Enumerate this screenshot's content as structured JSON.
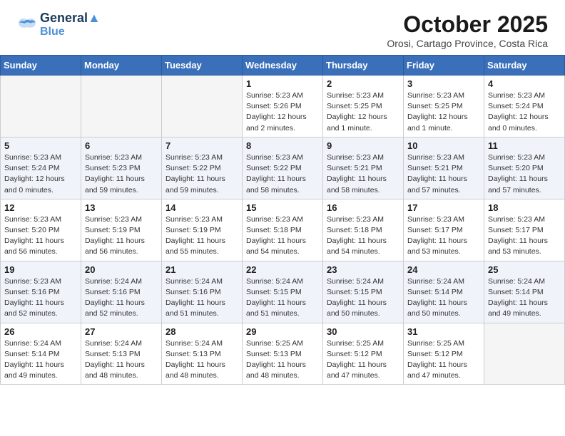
{
  "header": {
    "logo_line1": "General",
    "logo_line2": "Blue",
    "month_title": "October 2025",
    "subtitle": "Orosi, Cartago Province, Costa Rica"
  },
  "days_of_week": [
    "Sunday",
    "Monday",
    "Tuesday",
    "Wednesday",
    "Thursday",
    "Friday",
    "Saturday"
  ],
  "weeks": [
    [
      {
        "day": "",
        "info": ""
      },
      {
        "day": "",
        "info": ""
      },
      {
        "day": "",
        "info": ""
      },
      {
        "day": "1",
        "info": "Sunrise: 5:23 AM\nSunset: 5:26 PM\nDaylight: 12 hours\nand 2 minutes."
      },
      {
        "day": "2",
        "info": "Sunrise: 5:23 AM\nSunset: 5:25 PM\nDaylight: 12 hours\nand 1 minute."
      },
      {
        "day": "3",
        "info": "Sunrise: 5:23 AM\nSunset: 5:25 PM\nDaylight: 12 hours\nand 1 minute."
      },
      {
        "day": "4",
        "info": "Sunrise: 5:23 AM\nSunset: 5:24 PM\nDaylight: 12 hours\nand 0 minutes."
      }
    ],
    [
      {
        "day": "5",
        "info": "Sunrise: 5:23 AM\nSunset: 5:24 PM\nDaylight: 12 hours\nand 0 minutes."
      },
      {
        "day": "6",
        "info": "Sunrise: 5:23 AM\nSunset: 5:23 PM\nDaylight: 11 hours\nand 59 minutes."
      },
      {
        "day": "7",
        "info": "Sunrise: 5:23 AM\nSunset: 5:22 PM\nDaylight: 11 hours\nand 59 minutes."
      },
      {
        "day": "8",
        "info": "Sunrise: 5:23 AM\nSunset: 5:22 PM\nDaylight: 11 hours\nand 58 minutes."
      },
      {
        "day": "9",
        "info": "Sunrise: 5:23 AM\nSunset: 5:21 PM\nDaylight: 11 hours\nand 58 minutes."
      },
      {
        "day": "10",
        "info": "Sunrise: 5:23 AM\nSunset: 5:21 PM\nDaylight: 11 hours\nand 57 minutes."
      },
      {
        "day": "11",
        "info": "Sunrise: 5:23 AM\nSunset: 5:20 PM\nDaylight: 11 hours\nand 57 minutes."
      }
    ],
    [
      {
        "day": "12",
        "info": "Sunrise: 5:23 AM\nSunset: 5:20 PM\nDaylight: 11 hours\nand 56 minutes."
      },
      {
        "day": "13",
        "info": "Sunrise: 5:23 AM\nSunset: 5:19 PM\nDaylight: 11 hours\nand 56 minutes."
      },
      {
        "day": "14",
        "info": "Sunrise: 5:23 AM\nSunset: 5:19 PM\nDaylight: 11 hours\nand 55 minutes."
      },
      {
        "day": "15",
        "info": "Sunrise: 5:23 AM\nSunset: 5:18 PM\nDaylight: 11 hours\nand 54 minutes."
      },
      {
        "day": "16",
        "info": "Sunrise: 5:23 AM\nSunset: 5:18 PM\nDaylight: 11 hours\nand 54 minutes."
      },
      {
        "day": "17",
        "info": "Sunrise: 5:23 AM\nSunset: 5:17 PM\nDaylight: 11 hours\nand 53 minutes."
      },
      {
        "day": "18",
        "info": "Sunrise: 5:23 AM\nSunset: 5:17 PM\nDaylight: 11 hours\nand 53 minutes."
      }
    ],
    [
      {
        "day": "19",
        "info": "Sunrise: 5:23 AM\nSunset: 5:16 PM\nDaylight: 11 hours\nand 52 minutes."
      },
      {
        "day": "20",
        "info": "Sunrise: 5:24 AM\nSunset: 5:16 PM\nDaylight: 11 hours\nand 52 minutes."
      },
      {
        "day": "21",
        "info": "Sunrise: 5:24 AM\nSunset: 5:16 PM\nDaylight: 11 hours\nand 51 minutes."
      },
      {
        "day": "22",
        "info": "Sunrise: 5:24 AM\nSunset: 5:15 PM\nDaylight: 11 hours\nand 51 minutes."
      },
      {
        "day": "23",
        "info": "Sunrise: 5:24 AM\nSunset: 5:15 PM\nDaylight: 11 hours\nand 50 minutes."
      },
      {
        "day": "24",
        "info": "Sunrise: 5:24 AM\nSunset: 5:14 PM\nDaylight: 11 hours\nand 50 minutes."
      },
      {
        "day": "25",
        "info": "Sunrise: 5:24 AM\nSunset: 5:14 PM\nDaylight: 11 hours\nand 49 minutes."
      }
    ],
    [
      {
        "day": "26",
        "info": "Sunrise: 5:24 AM\nSunset: 5:14 PM\nDaylight: 11 hours\nand 49 minutes."
      },
      {
        "day": "27",
        "info": "Sunrise: 5:24 AM\nSunset: 5:13 PM\nDaylight: 11 hours\nand 48 minutes."
      },
      {
        "day": "28",
        "info": "Sunrise: 5:24 AM\nSunset: 5:13 PM\nDaylight: 11 hours\nand 48 minutes."
      },
      {
        "day": "29",
        "info": "Sunrise: 5:25 AM\nSunset: 5:13 PM\nDaylight: 11 hours\nand 48 minutes."
      },
      {
        "day": "30",
        "info": "Sunrise: 5:25 AM\nSunset: 5:12 PM\nDaylight: 11 hours\nand 47 minutes."
      },
      {
        "day": "31",
        "info": "Sunrise: 5:25 AM\nSunset: 5:12 PM\nDaylight: 11 hours\nand 47 minutes."
      },
      {
        "day": "",
        "info": ""
      }
    ]
  ]
}
